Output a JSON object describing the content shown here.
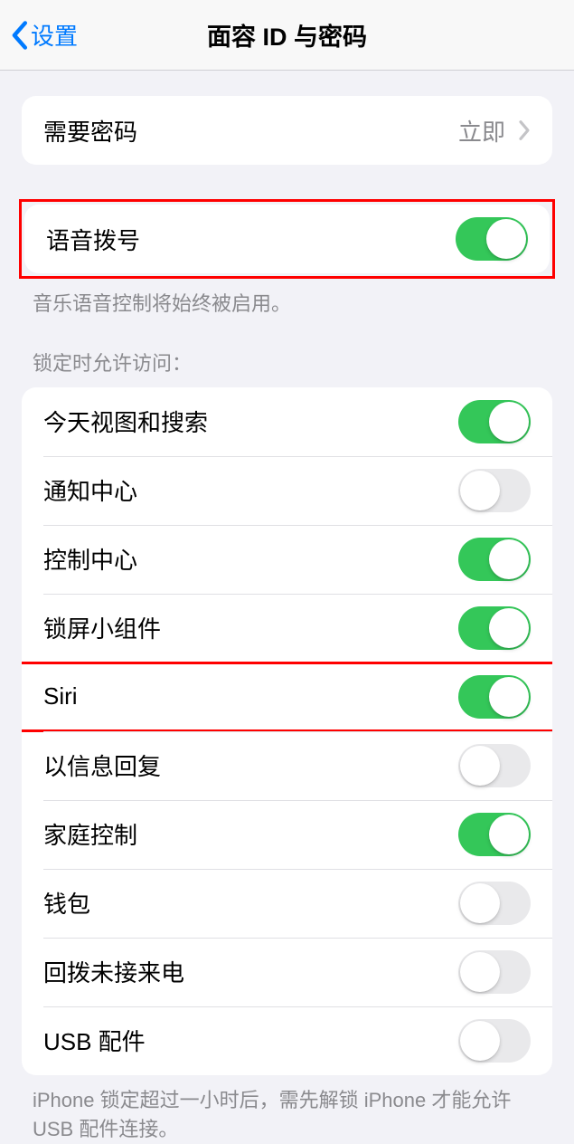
{
  "nav": {
    "back_label": "设置",
    "title": "面容 ID 与密码"
  },
  "group_passcode": {
    "label": "需要密码",
    "value": "立即"
  },
  "group_voice": {
    "label": "语音拨号",
    "on": true,
    "footer": "音乐语音控制将始终被启用。"
  },
  "group_lock": {
    "header": "锁定时允许访问：",
    "items": [
      {
        "label": "今天视图和搜索",
        "on": true,
        "highlighted": false
      },
      {
        "label": "通知中心",
        "on": false,
        "highlighted": false
      },
      {
        "label": "控制中心",
        "on": true,
        "highlighted": false
      },
      {
        "label": "锁屏小组件",
        "on": true,
        "highlighted": false
      },
      {
        "label": "Siri",
        "on": true,
        "highlighted": true
      },
      {
        "label": "以信息回复",
        "on": false,
        "highlighted": false
      },
      {
        "label": "家庭控制",
        "on": true,
        "highlighted": false
      },
      {
        "label": "钱包",
        "on": false,
        "highlighted": false
      },
      {
        "label": "回拨未接来电",
        "on": false,
        "highlighted": false
      },
      {
        "label": "USB 配件",
        "on": false,
        "highlighted": false
      }
    ],
    "footer": "iPhone 锁定超过一小时后，需先解锁 iPhone 才能允许 USB 配件连接。"
  }
}
